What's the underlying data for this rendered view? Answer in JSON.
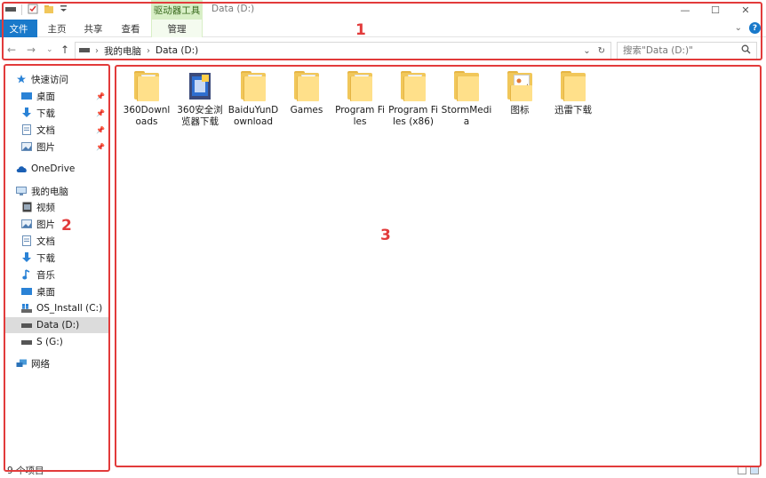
{
  "window": {
    "title": "Data (D:)",
    "context_group": "驱动器工具",
    "controls": {
      "minimize": "—",
      "maximize": "☐",
      "close": "✕"
    }
  },
  "ribbon": {
    "tabs": {
      "file": "文件",
      "home": "主页",
      "share": "共享",
      "view": "查看",
      "manage": "管理"
    },
    "collapse": "⌄",
    "help": "?"
  },
  "address": {
    "back": "←",
    "forward": "→",
    "recent": "⌄",
    "up": "↑",
    "crumbs": [
      "我的电脑",
      "Data (D:)"
    ],
    "dropdown": "⌄",
    "refresh": "↻"
  },
  "search": {
    "placeholder": "搜索\"Data (D:)\""
  },
  "annotations": {
    "one": "1",
    "two": "2",
    "three": "3"
  },
  "nav": {
    "quick_access": "快速访问",
    "quick_items": [
      "桌面",
      "下载",
      "文档",
      "图片"
    ],
    "onedrive": "OneDrive",
    "this_pc": "我的电脑",
    "pc_items": [
      "视频",
      "图片",
      "文档",
      "下载",
      "音乐",
      "桌面"
    ],
    "drives": [
      "OS_Install (C:)",
      "Data (D:)",
      "S (G:)"
    ],
    "network": "网络"
  },
  "files": [
    {
      "name": "360Downloads",
      "icon": "folder-icon"
    },
    {
      "name": "360安全浏览器下载",
      "icon": "special-folder-icon"
    },
    {
      "name": "BaiduYunDownload",
      "icon": "folder-icon"
    },
    {
      "name": "Games",
      "icon": "folder-icon"
    },
    {
      "name": "Program Files",
      "icon": "folder-icon"
    },
    {
      "name": "Program Files (x86)",
      "icon": "folder-icon"
    },
    {
      "name": "StormMedia",
      "icon": "folder-icon"
    },
    {
      "name": "图标",
      "icon": "image-folder-icon"
    },
    {
      "name": "迅雷下载",
      "icon": "folder-icon"
    }
  ],
  "status": {
    "count": "9 个项目"
  },
  "colors": {
    "accent": "#1979ca",
    "annotation": "#e23b3b",
    "context_tab": "#d8efc6",
    "folder": "#f1c75a"
  }
}
